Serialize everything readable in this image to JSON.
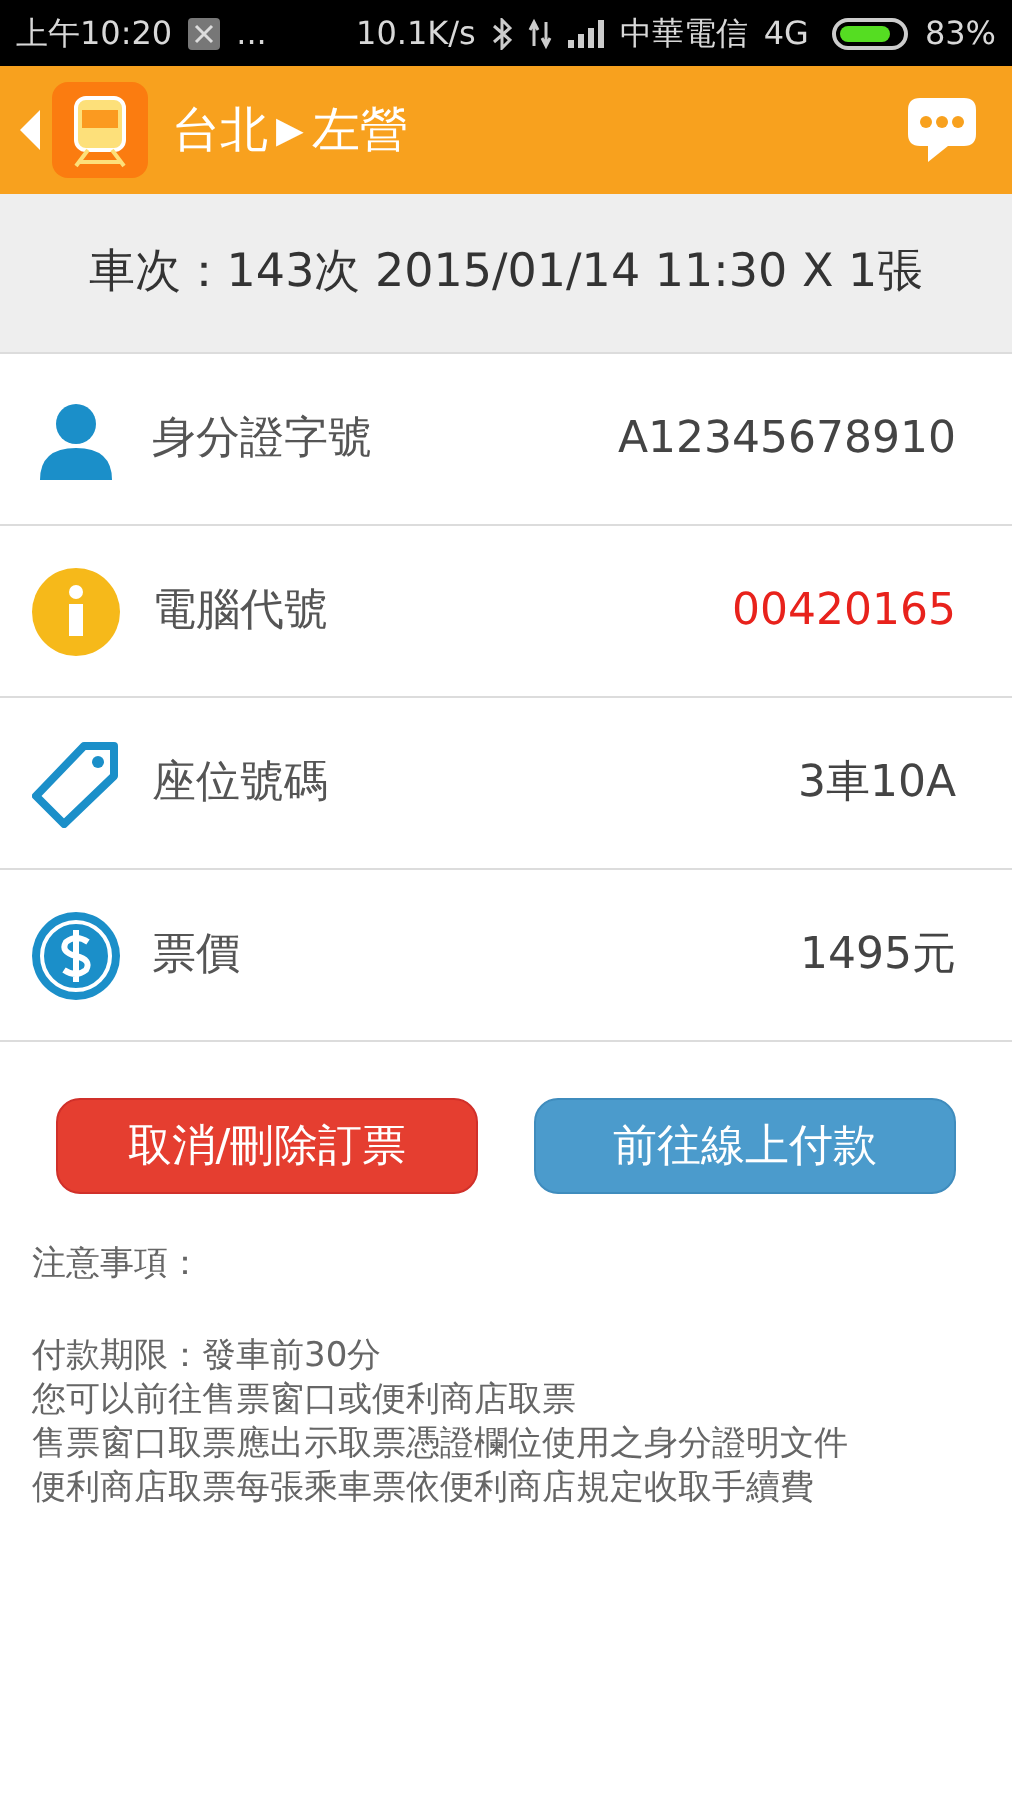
{
  "status_bar": {
    "time": "上午10:20",
    "more": "...",
    "speed": "10.1K/s",
    "carrier": "中華電信",
    "network": "4G",
    "battery": "83%"
  },
  "header": {
    "from": "台北",
    "arrow": "▶",
    "to": "左營"
  },
  "trip": {
    "summary": "車次：143次 2015/01/14 11:30 X 1張"
  },
  "rows": [
    {
      "kind": "person",
      "label": "身分證字號",
      "value": "A12345678910",
      "highlight": false
    },
    {
      "kind": "info",
      "label": "電腦代號",
      "value": "00420165",
      "highlight": true
    },
    {
      "kind": "tag",
      "label": "座位號碼",
      "value": "3車10A",
      "highlight": false
    },
    {
      "kind": "dollar",
      "label": "票價",
      "value": "1495元",
      "highlight": false
    }
  ],
  "buttons": [
    {
      "kind": "cancel",
      "label": "取消/刪除訂票"
    },
    {
      "kind": "pay",
      "label": "前往線上付款"
    }
  ],
  "notes": {
    "title": "注意事項：",
    "lines": [
      "付款期限：發車前30分",
      "您可以前往售票窗口或便利商店取票",
      "售票窗口取票應出示取票憑證欄位使用之身分證明文件",
      "便利商店取票每張乘車票依便利商店規定收取手續費"
    ]
  }
}
